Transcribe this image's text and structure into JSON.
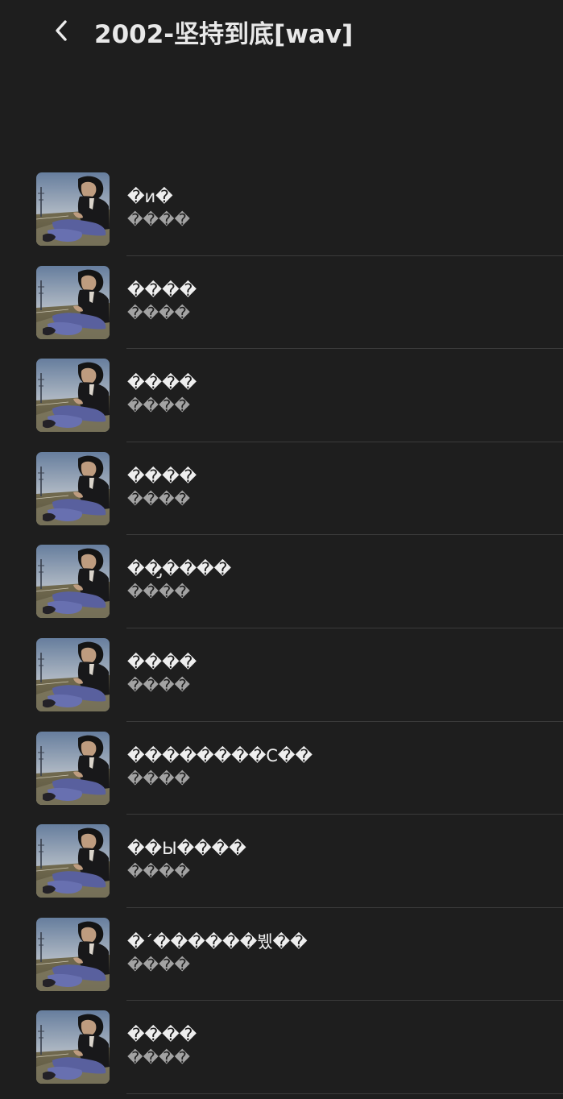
{
  "header": {
    "title": "2002-坚持到底[wav]",
    "back_icon": "chevron-left-icon"
  },
  "cover_icon": "album-cover-image",
  "tracks": [
    {
      "title": "�и�",
      "artist": "����"
    },
    {
      "title": "����",
      "artist": "����"
    },
    {
      "title": "����",
      "artist": "����"
    },
    {
      "title": "����",
      "artist": "����"
    },
    {
      "title": "��̡����",
      "artist": "����"
    },
    {
      "title": "����",
      "artist": "����"
    },
    {
      "title": "��������C��",
      "artist": "����"
    },
    {
      "title": "��Ы����",
      "artist": "����"
    },
    {
      "title": "�´������뷌��",
      "artist": "����"
    },
    {
      "title": "����",
      "artist": "����"
    }
  ]
}
